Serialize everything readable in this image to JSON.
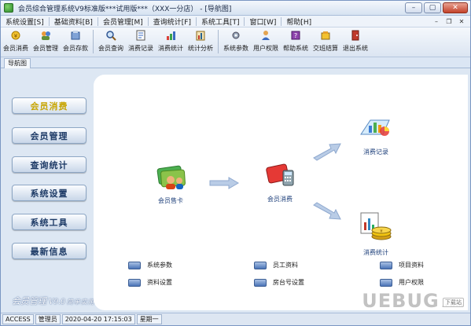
{
  "window": {
    "title": "会员综合管理系统V9标准版***试用版***（XXX一分店） - [导航图]",
    "controls": {
      "minimize": "–",
      "maximize": "▢",
      "close": "✕"
    }
  },
  "menubar": {
    "items": [
      "系统设置[S]",
      "基础资料[B]",
      "会员管理[M]",
      "查询统计[F]",
      "系统工具[T]",
      "窗口[W]",
      "帮助[H]"
    ],
    "mdi_controls": {
      "minimize": "–",
      "restore": "❐",
      "close": "✕"
    }
  },
  "toolbar": {
    "groups": [
      [
        {
          "label": "会员消费",
          "icon": "coin-icon"
        },
        {
          "label": "会员管理",
          "icon": "members-icon"
        },
        {
          "label": "会员存款",
          "icon": "deposit-icon"
        }
      ],
      [
        {
          "label": "会员查询",
          "icon": "search-icon"
        },
        {
          "label": "消费记录",
          "icon": "records-icon"
        },
        {
          "label": "消费统计",
          "icon": "stats-icon"
        },
        {
          "label": "统计分析",
          "icon": "analysis-icon"
        }
      ],
      [
        {
          "label": "系统参数",
          "icon": "settings-icon"
        },
        {
          "label": "用户权限",
          "icon": "user-permission-icon"
        },
        {
          "label": "帮助系统",
          "icon": "help-icon"
        },
        {
          "label": "交班结算",
          "icon": "handover-icon"
        },
        {
          "label": "退出系统",
          "icon": "exit-icon"
        }
      ]
    ]
  },
  "tab": {
    "label": "导航图"
  },
  "nav": {
    "items": [
      {
        "label": "会员消费",
        "active": true
      },
      {
        "label": "会员管理",
        "active": false
      },
      {
        "label": "查询统计",
        "active": false
      },
      {
        "label": "系统设置",
        "active": false
      },
      {
        "label": "系统工具",
        "active": false
      },
      {
        "label": "最新信息",
        "active": false
      }
    ]
  },
  "flow": {
    "card_sale": "会员售卡",
    "consume": "会员消费",
    "records": "消费记录",
    "stats": "消费统计"
  },
  "links": {
    "items": [
      "系统参数",
      "员工资料",
      "项目资料",
      "资料设置",
      "房台号设置",
      "用户权限"
    ]
  },
  "logo": {
    "text": "会员管理",
    "version": "V9.0",
    "slogan": "简单实用强大"
  },
  "statusbar": {
    "cells": [
      "ACCESS",
      "管理员",
      "2020-04-20 17:15:03",
      "星期一"
    ]
  },
  "watermark": {
    "brand": "UEBUG",
    "suffix": ".com",
    "tag": "下载站"
  },
  "colors": {
    "active_nav": "#c7a400",
    "nav_text": "#1d3a66",
    "accent_blue": "#3b5d94"
  }
}
